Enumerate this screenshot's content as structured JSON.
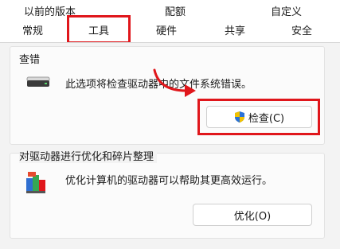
{
  "tabs_row1": [
    "以前的版本",
    "配额",
    "自定义"
  ],
  "tabs_row2": [
    "常规",
    "工具",
    "硬件",
    "共享",
    "安全"
  ],
  "error_check": {
    "title": "查错",
    "description": "此选项将检查驱动器中的文件系统错误。",
    "button_label": "检查(C)"
  },
  "optimize": {
    "title": "对驱动器进行优化和碎片整理",
    "description": "优化计算机的驱动器可以帮助其更高效运行。",
    "button_label": "优化(O)"
  },
  "colors": {
    "highlight": "#e0161b",
    "arrow": "#e0161b"
  },
  "icons": [
    "drive-icon",
    "shield-icon",
    "defrag-icon"
  ]
}
